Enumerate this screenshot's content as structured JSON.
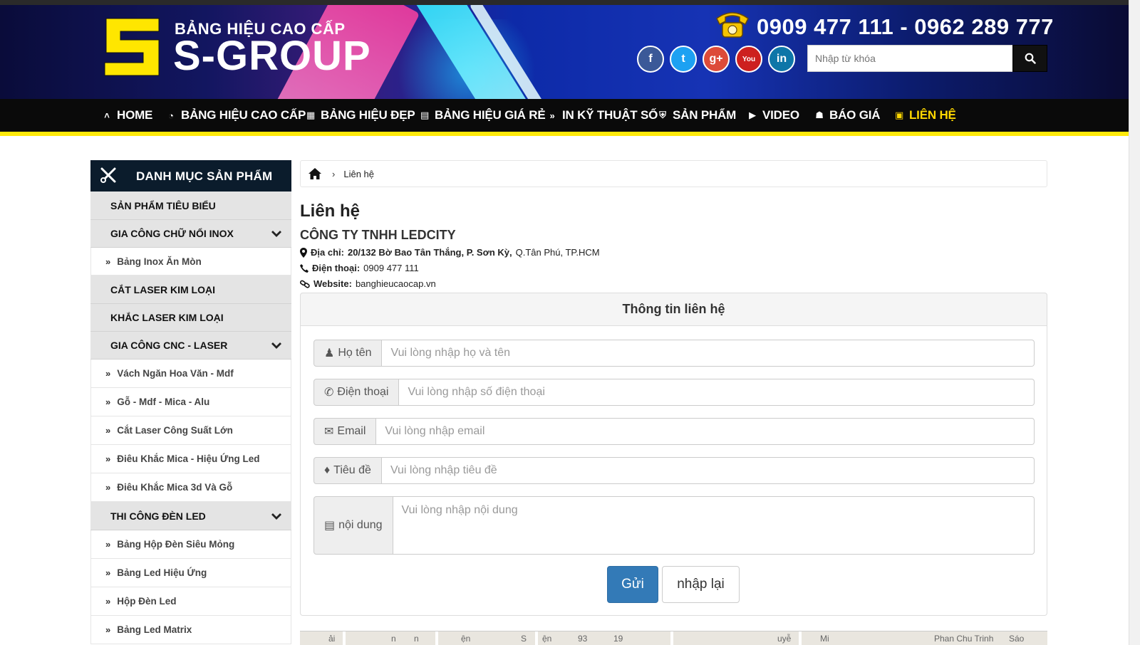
{
  "header": {
    "brand_tagline": "BẢNG HIỆU CAO CẤP",
    "brand_name": "S-GROUP",
    "phones": "0909 477 111 - 0962 289 777",
    "social": [
      {
        "name": "facebook",
        "glyph": "f",
        "color": "#3b5998"
      },
      {
        "name": "twitter",
        "glyph": "t",
        "color": "#1da1f2"
      },
      {
        "name": "google-plus",
        "glyph": "g+",
        "color": "#dd4b39"
      },
      {
        "name": "youtube",
        "glyph": "You",
        "color": "#cd201f"
      },
      {
        "name": "linkedin",
        "glyph": "in",
        "color": "#0e76a8"
      }
    ],
    "search_placeholder": "Nhập từ khóa"
  },
  "nav": {
    "items": [
      {
        "label": "HOME",
        "icon": "chevrons-up-icon"
      },
      {
        "label": "BẢNG HIỆU CAO CẤP",
        "icon": "gauge-icon"
      },
      {
        "label": "BẢNG HIỆU ĐẸP",
        "icon": "calendar-icon"
      },
      {
        "label": "BẢNG HIỆU GIÁ RẺ",
        "icon": "card-icon"
      },
      {
        "label": "IN KỸ THUẬT SỐ",
        "icon": "double-chevron-icon"
      },
      {
        "label": "SẢN PHẨM",
        "icon": "shield-icon"
      },
      {
        "label": "VIDEO",
        "icon": "youtube-icon"
      },
      {
        "label": "BÁO GIÁ",
        "icon": "users-icon"
      },
      {
        "label": "LIÊN HỆ",
        "icon": "money-icon",
        "active": true
      }
    ]
  },
  "sidebar": {
    "title": "DANH MỤC SẢN PHẨM",
    "items": [
      {
        "label": "SẢN PHẨM TIÊU BIỂU",
        "type": "category"
      },
      {
        "label": "GIA CÔNG CHỮ NỔI INOX",
        "type": "category",
        "expandable": true
      },
      {
        "label": "Bảng Inox Ăn Mòn",
        "type": "sub"
      },
      {
        "label": "CẮT LASER KIM LOẠI",
        "type": "category"
      },
      {
        "label": "KHẮC LASER KIM LOẠI",
        "type": "category"
      },
      {
        "label": "GIA CÔNG CNC - LASER",
        "type": "category",
        "expandable": true
      },
      {
        "label": "Vách Ngăn Hoa Văn - Mdf",
        "type": "sub"
      },
      {
        "label": "Gỗ - Mdf - Mica - Alu",
        "type": "sub"
      },
      {
        "label": "Cắt Laser Công Suất Lớn",
        "type": "sub"
      },
      {
        "label": "Điêu Khắc Mica - Hiệu Ứng Led",
        "type": "sub"
      },
      {
        "label": "Điêu Khắc Mica 3d Và Gỗ",
        "type": "sub"
      },
      {
        "label": "THI CÔNG ĐÈN LED",
        "type": "category",
        "expandable": true
      },
      {
        "label": "Bảng Hộp Đèn Siêu Mỏng",
        "type": "sub"
      },
      {
        "label": "Bảng Led Hiệu Ứng",
        "type": "sub"
      },
      {
        "label": "Hộp Đèn Led",
        "type": "sub"
      },
      {
        "label": "Bảng Led Matrix",
        "type": "sub"
      }
    ]
  },
  "breadcrumb": {
    "current": "Liên hệ"
  },
  "main": {
    "title": "Liên hệ",
    "company": "CÔNG TY TNHH LEDCITY",
    "address_label": "Địa chỉ:",
    "address_bold": "20/132 Bờ Bao Tân Thắng, P. Sơn Kỳ,",
    "address_rest": "Q.Tân Phú, TP.HCM",
    "phone_label": "Điện thoại:",
    "phone_value": "0909 477 111",
    "website_label": "Website:",
    "website_value": "banghieucaocap.vn"
  },
  "form": {
    "heading": "Thông tin liên hệ",
    "name_label": "Họ tên",
    "name_placeholder": "Vui lòng nhập họ và tên",
    "phone_label": "Điện thoại",
    "phone_placeholder": "Vui lòng nhập số điện thoại",
    "email_label": "Email",
    "email_placeholder": "Vui lòng nhập email",
    "subject_label": "Tiêu đề",
    "subject_placeholder": "Vui lòng nhập tiêu đề",
    "content_label": "nội dung",
    "content_placeholder": "Vui lòng nhập nội dung",
    "submit_label": "Gửi",
    "reset_label": "nhập lại"
  },
  "map": {
    "labels": [
      "ải",
      "n",
      "S",
      "ện",
      "93",
      "19",
      "uyễ",
      "Mi",
      "Phan Chu Trinh",
      "Sáo"
    ]
  }
}
